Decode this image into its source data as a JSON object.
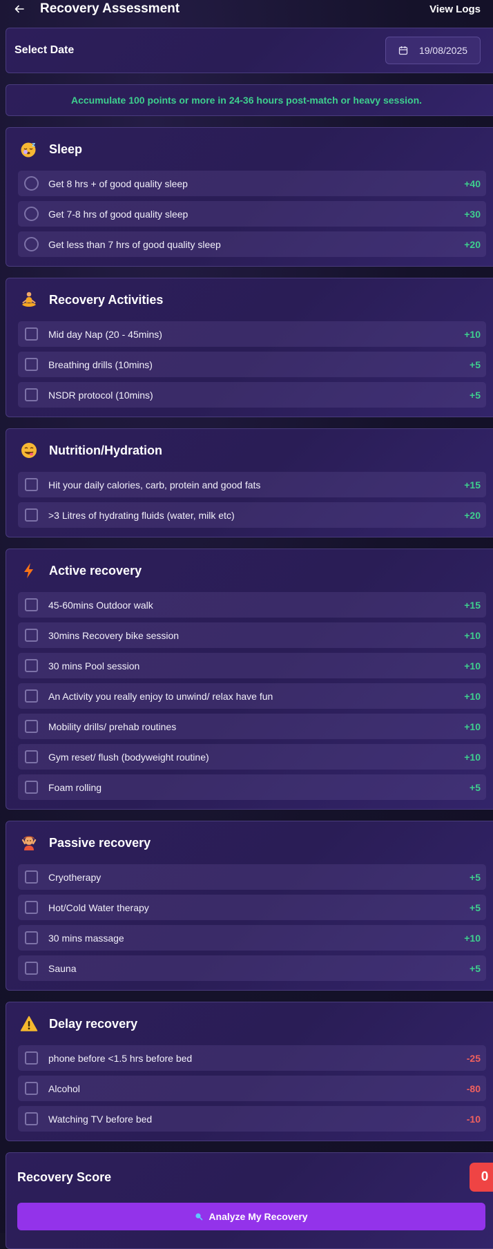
{
  "header": {
    "title": "Recovery Assessment",
    "view_logs": "View Logs"
  },
  "date": {
    "label": "Select Date",
    "value": "19/08/2025"
  },
  "info": "Accumulate 100 points or more in 24-36 hours post-match or heavy session.",
  "sections": [
    {
      "title": "Sleep",
      "icon": "sleeping-face-icon",
      "input": "radio",
      "items": [
        {
          "label": "Get 8 hrs + of good quality sleep",
          "points": "+40"
        },
        {
          "label": "Get 7-8 hrs of good quality sleep",
          "points": "+30"
        },
        {
          "label": "Get less than 7 hrs of good quality sleep",
          "points": "+20"
        }
      ]
    },
    {
      "title": "Recovery Activities",
      "icon": "meditation-icon",
      "input": "checkbox",
      "items": [
        {
          "label": "Mid day Nap (20 - 45mins)",
          "points": "+10"
        },
        {
          "label": "Breathing drills (10mins)",
          "points": "+5"
        },
        {
          "label": "NSDR protocol (10mins)",
          "points": "+5"
        }
      ]
    },
    {
      "title": "Nutrition/Hydration",
      "icon": "yum-face-icon",
      "input": "checkbox",
      "items": [
        {
          "label": "Hit your daily calories, carb, protein and good fats",
          "points": "+15"
        },
        {
          "label": ">3 Litres of hydrating fluids (water, milk etc)",
          "points": "+20"
        }
      ]
    },
    {
      "title": "Active recovery",
      "icon": "lightning-icon",
      "input": "checkbox",
      "items": [
        {
          "label": "45-60mins Outdoor walk",
          "points": "+15"
        },
        {
          "label": "30mins Recovery bike session",
          "points": "+10"
        },
        {
          "label": "30 mins Pool session",
          "points": "+10"
        },
        {
          "label": "An Activity you really enjoy to unwind/ relax have fun",
          "points": "+10"
        },
        {
          "label": "Mobility drills/ prehab routines",
          "points": "+10"
        },
        {
          "label": "Gym reset/ flush (bodyweight routine)",
          "points": "+10"
        },
        {
          "label": "Foam rolling",
          "points": "+5"
        }
      ]
    },
    {
      "title": "Passive recovery",
      "icon": "massage-icon",
      "input": "checkbox",
      "items": [
        {
          "label": "Cryotherapy",
          "points": "+5"
        },
        {
          "label": "Hot/Cold Water therapy",
          "points": "+5"
        },
        {
          "label": "30 mins massage",
          "points": "+10"
        },
        {
          "label": "Sauna",
          "points": "+5"
        }
      ]
    },
    {
      "title": "Delay recovery",
      "icon": "warning-icon",
      "input": "checkbox",
      "items": [
        {
          "label": "phone before <1.5 hrs before bed",
          "points": "-25"
        },
        {
          "label": "Alcohol",
          "points": "-80"
        },
        {
          "label": "Watching TV before bed",
          "points": "-10"
        }
      ]
    }
  ],
  "score": {
    "label": "Recovery Score",
    "value": "0"
  },
  "analyze": {
    "label": "Analyze My Recovery"
  },
  "colors": {
    "accent": "#9333ea",
    "positive": "#3ecf8e",
    "negative": "#f0605e",
    "badge": "#ef4444"
  }
}
